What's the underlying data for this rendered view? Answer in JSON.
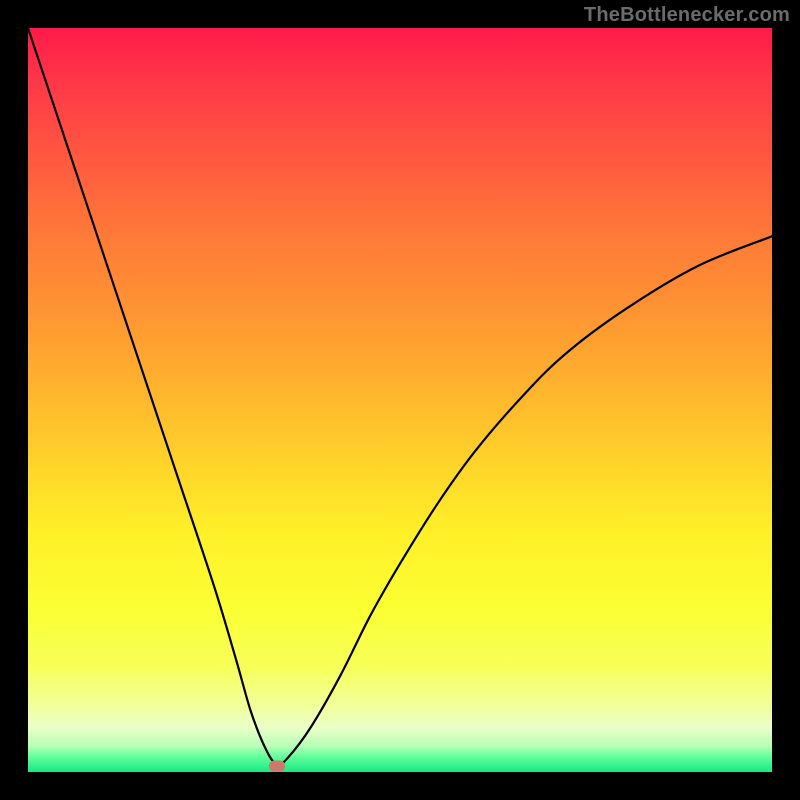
{
  "watermark": "TheBottlenecker.com",
  "chart_data": {
    "type": "line",
    "title": "",
    "xlabel": "",
    "ylabel": "",
    "xlim": [
      0,
      100
    ],
    "ylim": [
      0,
      100
    ],
    "grid": false,
    "legend": false,
    "background": "vertical-gradient red→orange→yellow→green",
    "series": [
      {
        "name": "bottleneck-curve",
        "x": [
          0,
          5,
          10,
          15,
          20,
          25,
          28,
          30,
          32,
          33.5,
          35,
          38,
          42,
          46,
          50,
          55,
          60,
          66,
          72,
          80,
          90,
          100
        ],
        "y": [
          100,
          85,
          70,
          55,
          40,
          25,
          15,
          8,
          3,
          1,
          2,
          6,
          13,
          21,
          28,
          36,
          43,
          50,
          56,
          62,
          68,
          72
        ]
      }
    ],
    "marker": {
      "x": 33.5,
      "y": 0.8,
      "color": "#c97a6a"
    }
  }
}
